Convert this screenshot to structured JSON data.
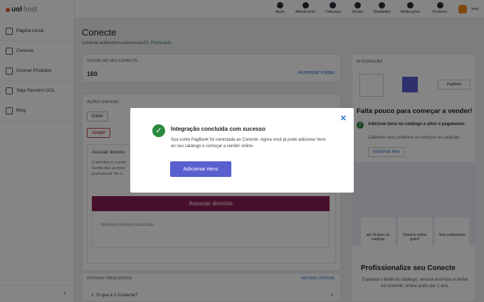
{
  "brand": {
    "name": "uol",
    "suffix": "host"
  },
  "sidebar": {
    "items": [
      {
        "label": "Página inicial",
        "icon": "home-icon"
      },
      {
        "label": "Conecte",
        "icon": "store-icon"
      },
      {
        "label": "Assinar Produtos",
        "icon": "box-icon"
      },
      {
        "label": "Seja Parceiro UOL",
        "icon": "handshake-icon"
      },
      {
        "label": "Blog",
        "icon": "blog-icon"
      }
    ]
  },
  "topbar": {
    "items": [
      {
        "label": "Ajuda",
        "icon": "help-icon"
      },
      {
        "label": "Atendimento",
        "icon": "headset-icon"
      },
      {
        "label": "Cobrança",
        "icon": "billing-icon"
      },
      {
        "label": "Vendas",
        "icon": "dollar-icon"
      },
      {
        "label": "Novidades",
        "icon": "megaphone-icon"
      },
      {
        "label": "Notificações",
        "icon": "bell-icon"
      },
      {
        "label": "Produtos",
        "icon": "grid-icon"
      }
    ],
    "user": "Inna"
  },
  "page": {
    "title": "Conecte",
    "url": "conecte.online/em-construcao02",
    "status": "Publicado"
  },
  "visits": {
    "label": "VISITAS NO SEU CONECTE",
    "value": "160",
    "link": "Aumentar visitas"
  },
  "actions": {
    "label": "AÇÕES RÁPIDAS",
    "edit": "Editar",
    "delete": "Apagar"
  },
  "domain": {
    "title": "Associar domínio",
    "text1": "O domínio é o ende",
    "text2": "facilita que as pess",
    "text3": "profissional. Ter o",
    "button": "Associar domínio",
    "none": "Nenhum domínio associado"
  },
  "faq": {
    "label": "DÚVIDAS FREQUENTES",
    "more": "VER MAIS DÚVIDAS",
    "q1": "1. O que é o Conecte?"
  },
  "integration": {
    "label": "INTEGRAÇÃO",
    "partner": "PagBank",
    "headline": "Falta pouco para começar a vender!",
    "step_num": "2",
    "step_title": "Adicione itens no catálogo e ative o pagamento",
    "step_text": "Cadastre seus produtos ou serviços no catálogo",
    "step_link": "Adicionar item"
  },
  "features": [
    {
      "label": "até 30 itens no catálogo",
      "icon": "cart-icon"
    },
    {
      "label": "Domínio online grátis*",
      "icon": "globe-icon"
    },
    {
      "label": "Sem publicidade",
      "icon": "no-ads-icon"
    }
  ],
  "promo": {
    "title": "Profissionalize seu Conecte",
    "text": "Expanda o limite do catálogo, remova anúncios e tenha um domínio .online grátis por 1 ano."
  },
  "modal": {
    "title": "Integração concluída com sucesso",
    "text": "Sua conta PagBank foi conectada ao Conecte. Agora você já pode adicionar itens ao seu catálogo e começar a vender online.",
    "button": "Adicionar itens",
    "close": "✕",
    "check": "✓"
  },
  "colors": {
    "accent": "#5a5fcf",
    "success": "#2b8a3e",
    "wine": "#8b1d54",
    "link": "#2a6fd1"
  }
}
